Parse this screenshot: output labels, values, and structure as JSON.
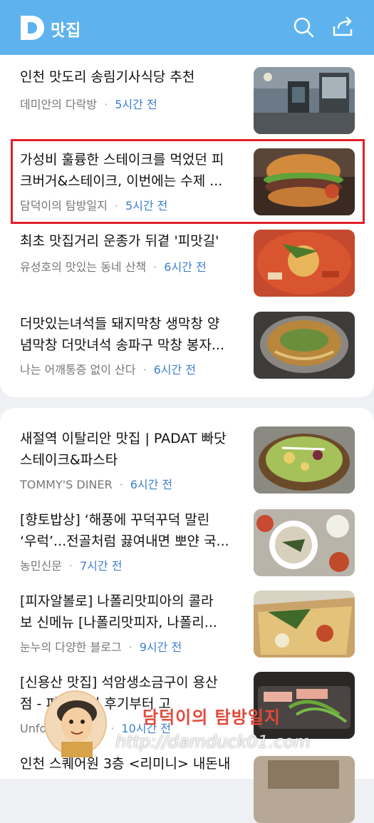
{
  "header": {
    "logo_letter": "D",
    "title": "맛집",
    "bg_color": "#5eb3ee"
  },
  "articles": [
    {
      "title_lines": [
        "인천 맛도리 송림기사식당 추천"
      ],
      "source": "데미안의 다락방",
      "time": "5시간 전",
      "thumb": "restaurant-interior"
    },
    {
      "title_lines": [
        "가성비 훌륭한 스테이크를 먹었던 피",
        "크버거&스테이크, 이번에는 수제 ..."
      ],
      "source": "담덕이의 탐방일지",
      "time": "5시간 전",
      "thumb": "burger",
      "highlighted": true
    },
    {
      "title_lines": [
        "최초 맛집거리 운종가 뒤곁 '피맛길'"
      ],
      "source": "유성호의 맛있는 동네 산책",
      "time": "6시간 전",
      "thumb": "stew"
    },
    {
      "title_lines": [
        "더맛있는녀석들 돼지막창 생막창 양",
        "념막창 더맛녀석 송파구 막창 봉자..."
      ],
      "source": "나는 어깨통증 없이 산다",
      "time": "6시간 전",
      "thumb": "noodle-soup"
    },
    {
      "title_lines": [
        "새절역 이탈리안 맛집 | PADAT 빠닷",
        "스테이크&파스타"
      ],
      "source": "TOMMY'S DINER",
      "time": "6시간 전",
      "thumb": "salad-bowl"
    },
    {
      "title_lines": [
        "[향토밥상] ‘해풍에 꾸덕꾸덕 말린",
        "‘우럭’...전골처럼 끓여내면 뽀얀 국..."
      ],
      "source": "농민신문",
      "time": "7시간 전",
      "thumb": "fish-soup"
    },
    {
      "title_lines": [
        "[피자알볼로] 나폴리맛피아의 콜라",
        "보 신메뉴 [나폴리맛피자, 나폴리..."
      ],
      "source": "눈누의 다양한 블로그",
      "time": "9시간 전",
      "thumb": "pizza"
    },
    {
      "title_lines": [
        "[신용산 맛집] 석암생소금구이 용산",
        "점 - 피      웨이팅 후기부터 고"
      ],
      "source": "Unfo            ammyk...",
      "time": "10시간 전",
      "thumb": "grilled-meat"
    },
    {
      "title_lines": [
        "인천 스퀘어원 3층 <리미니> 내돈내"
      ],
      "source": "",
      "time": "",
      "thumb": "restaurant"
    }
  ],
  "watermark": {
    "name": "담덕이의 탐방일지",
    "url": "http://damduck01.com"
  },
  "colors": {
    "time": "#3d7fcf",
    "highlight": "#e3202a"
  }
}
